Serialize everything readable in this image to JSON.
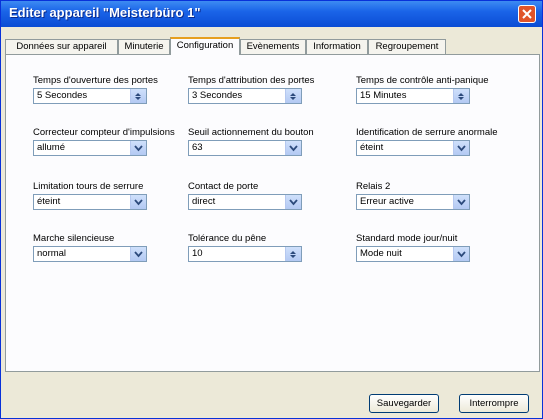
{
  "window": {
    "title": "Editer appareil \"Meisterbüro 1\""
  },
  "tabs": [
    {
      "label": "Données sur appareil"
    },
    {
      "label": "Minuterie"
    },
    {
      "label": "Configuration",
      "active": true
    },
    {
      "label": "Evènements"
    },
    {
      "label": "Information"
    },
    {
      "label": "Regroupement"
    }
  ],
  "fields": [
    {
      "label": "Temps d'ouverture des portes",
      "value": "5 Secondes",
      "kind": "spinner"
    },
    {
      "label": "Temps d'attribution des portes",
      "value": "3 Secondes",
      "kind": "spinner"
    },
    {
      "label": "Temps de contrôle anti-panique",
      "value": "15 Minutes",
      "kind": "spinner"
    },
    {
      "label": "Correcteur compteur d'impulsions",
      "value": "allumé",
      "kind": "dropdown"
    },
    {
      "label": "Seuil actionnement du bouton",
      "value": "63",
      "kind": "dropdown"
    },
    {
      "label": "Identification de serrure anormale",
      "value": "éteint",
      "kind": "dropdown"
    },
    {
      "label": "Limitation tours de serrure",
      "value": "éteint",
      "kind": "dropdown"
    },
    {
      "label": "Contact de porte",
      "value": "direct",
      "kind": "dropdown"
    },
    {
      "label": "Relais 2",
      "value": "Erreur active",
      "kind": "dropdown"
    },
    {
      "label": "Marche silencieuse",
      "value": "normal",
      "kind": "dropdown"
    },
    {
      "label": "Tolérance du pêne",
      "value": "10",
      "kind": "spinner"
    },
    {
      "label": "Standard mode jour/nuit",
      "value": "Mode nuit",
      "kind": "dropdown"
    }
  ],
  "footer": {
    "save_label": "Sauvegarder",
    "cancel_label": "Interrompre"
  },
  "colors": {
    "titlebar": "#0a4cd4",
    "close": "#e0542a",
    "active_tab_accent": "#e69f1f",
    "dialog_bg": "#ece9d8"
  }
}
